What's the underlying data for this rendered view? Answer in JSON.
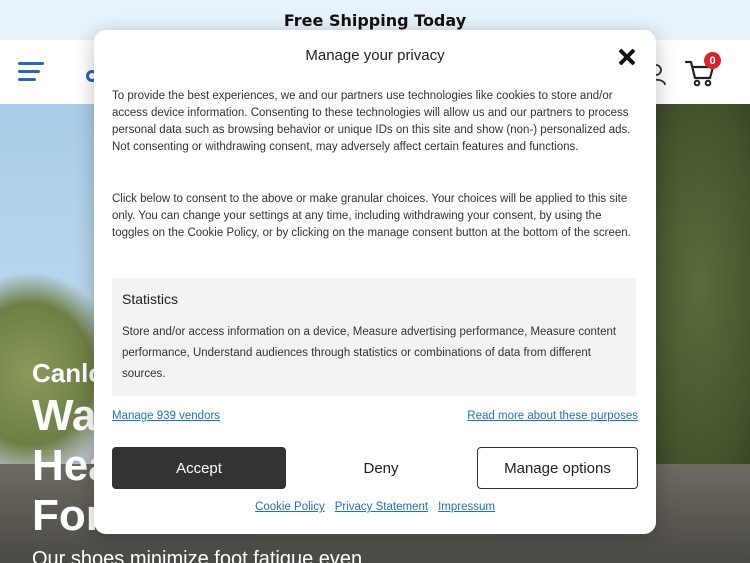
{
  "topbar": {
    "text": "Free Shipping Today"
  },
  "header": {
    "cart_count": "0",
    "colors": {
      "brand": "#2a66b8",
      "badge": "#d9232a"
    }
  },
  "hero": {
    "eyebrow": "Canlo",
    "line1": "Wa",
    "line2": "Hea",
    "line3": "For",
    "subtitle": "Our shoes minimize foot fatigue even"
  },
  "modal": {
    "title": "Manage your privacy",
    "paragraph1": "To provide the best experiences, we and our partners use technologies like cookies to store and/or access device information. Consenting to these technologies will allow us and our partners to process personal data such as browsing behavior or unique IDs on this site and show (non-) personalized ads. Not consenting or withdrawing consent, may adversely affect certain features and functions.",
    "paragraph2": "Click below to consent to the above or make granular choices. Your choices will be applied to this site only. You can change your settings at any time, including withdrawing your consent, by using the toggles on the Cookie Policy, or by clicking on the manage consent button at the bottom of the screen.",
    "statistics": {
      "title": "Statistics",
      "description": "Store and/or access information on a device, Measure advertising performance, Measure content performance, Understand audiences through statistics or combinations of data from different sources."
    },
    "vendors_link": "Manage 939 vendors",
    "purposes_link": "Read more about these purposes",
    "buttons": {
      "accept": "Accept",
      "deny": "Deny",
      "manage": "Manage options"
    },
    "footer_links": {
      "cookie_policy": "Cookie Policy",
      "privacy_statement": "Privacy Statement",
      "impressum": "Impressum"
    },
    "colors": {
      "accept_bg": "#333333",
      "link": "#1e73be"
    }
  }
}
